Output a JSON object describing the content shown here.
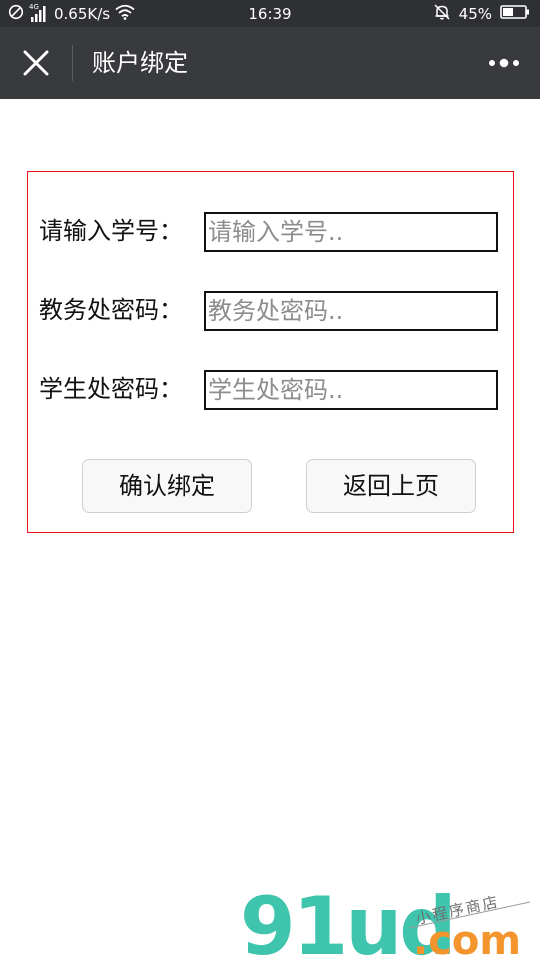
{
  "status_bar": {
    "network_type": "4G",
    "speed": "0.65K/s",
    "time": "16:39",
    "battery": "45%"
  },
  "nav": {
    "title": "账户绑定"
  },
  "form": {
    "rows": [
      {
        "label": "请输入学号：",
        "placeholder": "请输入学号..",
        "value": ""
      },
      {
        "label": "教务处密码：",
        "placeholder": "教务处密码..",
        "value": ""
      },
      {
        "label": "学生处密码：",
        "placeholder": "学生处密码..",
        "value": ""
      }
    ],
    "confirm_label": "确认绑定",
    "back_label": "返回上页"
  },
  "watermark": {
    "brand": "91ud",
    "domain": ".com",
    "tagline": "小程序商店"
  },
  "colors": {
    "status_bar_bg": "#2e3033",
    "nav_bg": "#393a3e",
    "form_border": "#e8141b",
    "watermark_teal": "#3fc4ae",
    "watermark_lime": "#b3d91a",
    "watermark_orange": "#f3952c"
  }
}
